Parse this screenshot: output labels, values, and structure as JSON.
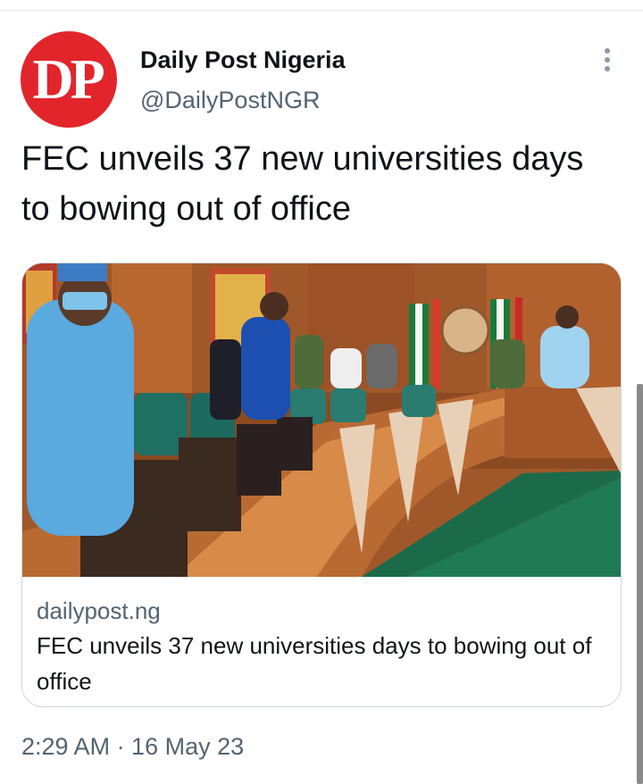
{
  "tweet": {
    "avatar_logo": "DP",
    "display_name": "Daily Post Nigeria",
    "handle": "@DailyPostNGR",
    "more_icon": "more-vertical-icon",
    "text": "FEC unveils 37 new universities days to bowing out of office",
    "card": {
      "domain": "dailypost.ng",
      "title": "FEC unveils 37 new universities days to bowing out of office"
    },
    "timestamp": "2:29 AM · 16 May 23"
  },
  "colors": {
    "brand_red": "#e2252b",
    "secondary_text": "#536471",
    "primary_text": "#0f1419",
    "border": "#cfd9de"
  }
}
